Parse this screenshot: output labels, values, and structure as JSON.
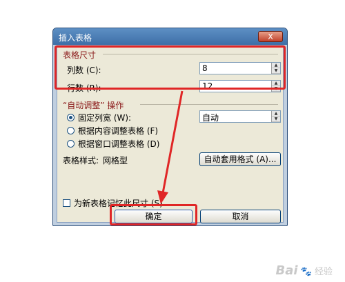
{
  "dialog": {
    "title": "插入表格",
    "close_label": "X"
  },
  "table_size": {
    "title": "表格尺寸",
    "columns_label": "列数 (C):",
    "columns_value": "8",
    "rows_label": "行数 (R):",
    "rows_value": "12"
  },
  "autofit": {
    "title": "“自动调整” 操作",
    "options": [
      {
        "label": "固定列宽 (W):",
        "checked": true
      },
      {
        "label": "根据内容调整表格 (F)",
        "checked": false
      },
      {
        "label": "根据窗口调整表格 (D)",
        "checked": false
      }
    ],
    "width_value": "自动"
  },
  "style": {
    "label": "表格样式:",
    "value": "网格型",
    "autoformat_button": "自动套用格式 (A)..."
  },
  "remember": {
    "label": "为新表格记忆此尺寸 (S)",
    "checked": false
  },
  "buttons": {
    "ok": "确定",
    "cancel": "取消"
  },
  "watermark": {
    "brand": "Bai",
    "suffix": "经验"
  },
  "colors": {
    "highlight": "#e02626",
    "group_title": "#8b1a1a"
  }
}
